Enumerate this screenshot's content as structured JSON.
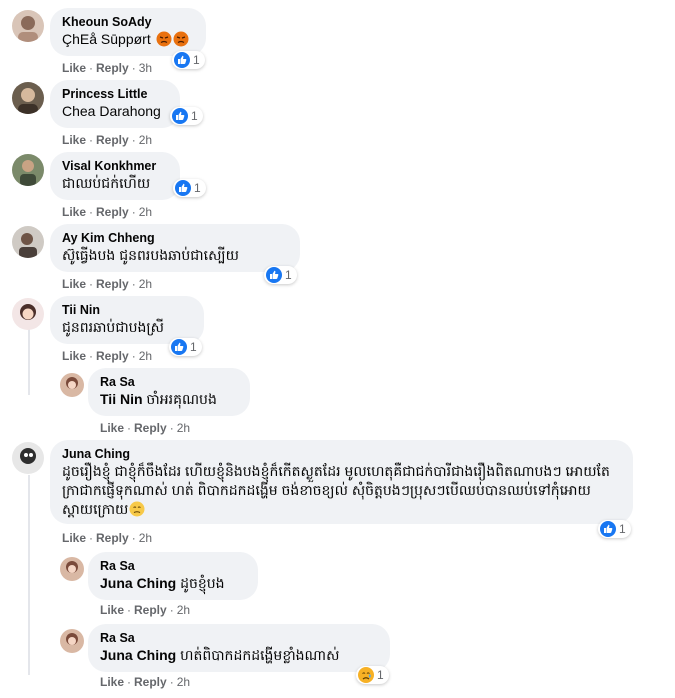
{
  "actions": {
    "like": "Like",
    "reply": "Reply",
    "sep": "·"
  },
  "comments": [
    {
      "author": "Kheoun SoAdy",
      "text": "ÇhEå Sūppørt",
      "time": "3h",
      "reaction_count": "1"
    },
    {
      "author": "Princess Little",
      "text": "Chea Darahong",
      "time": "2h",
      "reaction_count": "1"
    },
    {
      "author": "Visal Konkhmer",
      "text": "ជាឈប់ជក់ហើយ",
      "time": "2h",
      "reaction_count": "1"
    },
    {
      "author": "Ay Kim Chheng",
      "text": "ស៊ូធ្វើងបង ជូនពរបងឆាប់ជាស្បើយ",
      "time": "2h",
      "reaction_count": "1"
    },
    {
      "author": "Tii Nin",
      "text": "ជូនពរឆាប់ជាបងស្រី",
      "time": "2h",
      "reaction_count": "1"
    },
    {
      "author": "Ra Sa",
      "mention": "Tii Nin",
      "text": "ចាំអរគុណបង",
      "time": "2h"
    },
    {
      "author": "Juna Ching",
      "text": "ដូចរឿងខ្ញុំ ជាខ្ញុំក៏ចឹងដែរ ហើយខ្ញុំនិងបងខ្ញុំក៏កើតស្ងួតដែរ មូលហេតុគឺជាជក់បារីជាងរឿងពិតណាបងៗ អោយតែក្រាជាកផ្ញើទុកណាស់ ហត់ ពិបាកដកដង្ហើម ចង់ខាចខ្យល់ សុំចិត្តបងៗប្រុសៗបើឈប់បានឈប់ទៅកុំអោយស្តាយក្រោយ",
      "time": "2h",
      "reaction_count": "1"
    },
    {
      "author": "Ra Sa",
      "mention": "Juna Ching",
      "text": "ដូចខ្ញុំបង",
      "time": "2h"
    },
    {
      "author": "Ra Sa",
      "mention": "Juna Ching",
      "text": "ហត់ពិបាកដកដង្ហើមខ្លាំងណាស់",
      "time": "2h",
      "reaction_count": "1"
    }
  ],
  "colors": {
    "bubble": "#f0f2f5",
    "like_blue": "#1877f2",
    "meta": "#65676b",
    "angry": "#e9710f"
  }
}
